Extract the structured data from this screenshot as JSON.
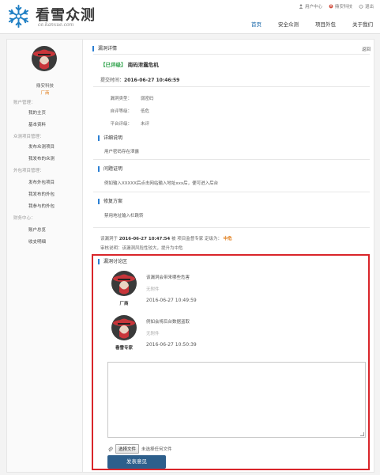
{
  "header": {
    "logo_cn": "看雪众测",
    "logo_en": "ce.kanxue.com",
    "links": [
      {
        "label": "用户中心",
        "icon": "user-icon"
      },
      {
        "label": "鼎安科技",
        "icon": "person-icon"
      },
      {
        "label": "退出",
        "icon": "power-icon"
      }
    ],
    "nav": [
      "首页",
      "安全众测",
      "项目外包",
      "关于我们"
    ]
  },
  "sidebar": {
    "username": "鼎安科技",
    "role": "厂商",
    "groups": [
      {
        "title": "账户管理：",
        "items": [
          "我的主页",
          "基本资料"
        ]
      },
      {
        "title": "众测项目管理：",
        "items": [
          "发布众测项目",
          "我发布的众测"
        ]
      },
      {
        "title": "外包项目管理：",
        "items": [
          "发布外包项目",
          "我发布的外包",
          "我参与的外包"
        ]
      },
      {
        "title": "财务中心：",
        "items": [
          "账户总览",
          "收支明细"
        ]
      }
    ]
  },
  "detail": {
    "section_title": "漏洞详情",
    "back_label": "返回",
    "status_tag": "【已评级】",
    "vuln_name": "南码泄露危机",
    "submit_label": "提交时间：",
    "submit_time": "2016-06-27 10:46:59",
    "fields": [
      {
        "label": "漏洞类型：",
        "value": "弱密码"
      },
      {
        "label": "自评等级：",
        "value": "低危"
      },
      {
        "label": "平台评级：",
        "value": "未评"
      }
    ],
    "desc_title": "详细说明",
    "desc_text": "用户密码存在泄露",
    "proof_title": "问题证明",
    "proof_text": "例如输入XXXXX后点击网站输入地址xxx后，便可进入后台",
    "fix_title": "修复方案",
    "fix_text": "禁用地址输入栏跳转",
    "audit_prefix": "该漏洞于",
    "audit_time": "2016-06-27 10:47:54",
    "audit_mid": "被 项目监督专家 定级为：",
    "audit_level": "中危",
    "audit_note_label": "审核说明：",
    "audit_note": "该漏洞风险性较大，提升为中危"
  },
  "discussion": {
    "title": "漏洞讨论区",
    "messages": [
      {
        "name": "厂商",
        "text": "该漏洞会带来哪些危害",
        "attach": "无附件",
        "time": "2016-06-27 10:49:59"
      },
      {
        "name": "看雪专家",
        "text": "例如会将后台数据盗取",
        "attach": "无附件",
        "time": "2016-06-27 10:50:39"
      }
    ],
    "file_button": "选择文件",
    "file_status": "未选择任何文件",
    "submit_label": "发表意见"
  }
}
